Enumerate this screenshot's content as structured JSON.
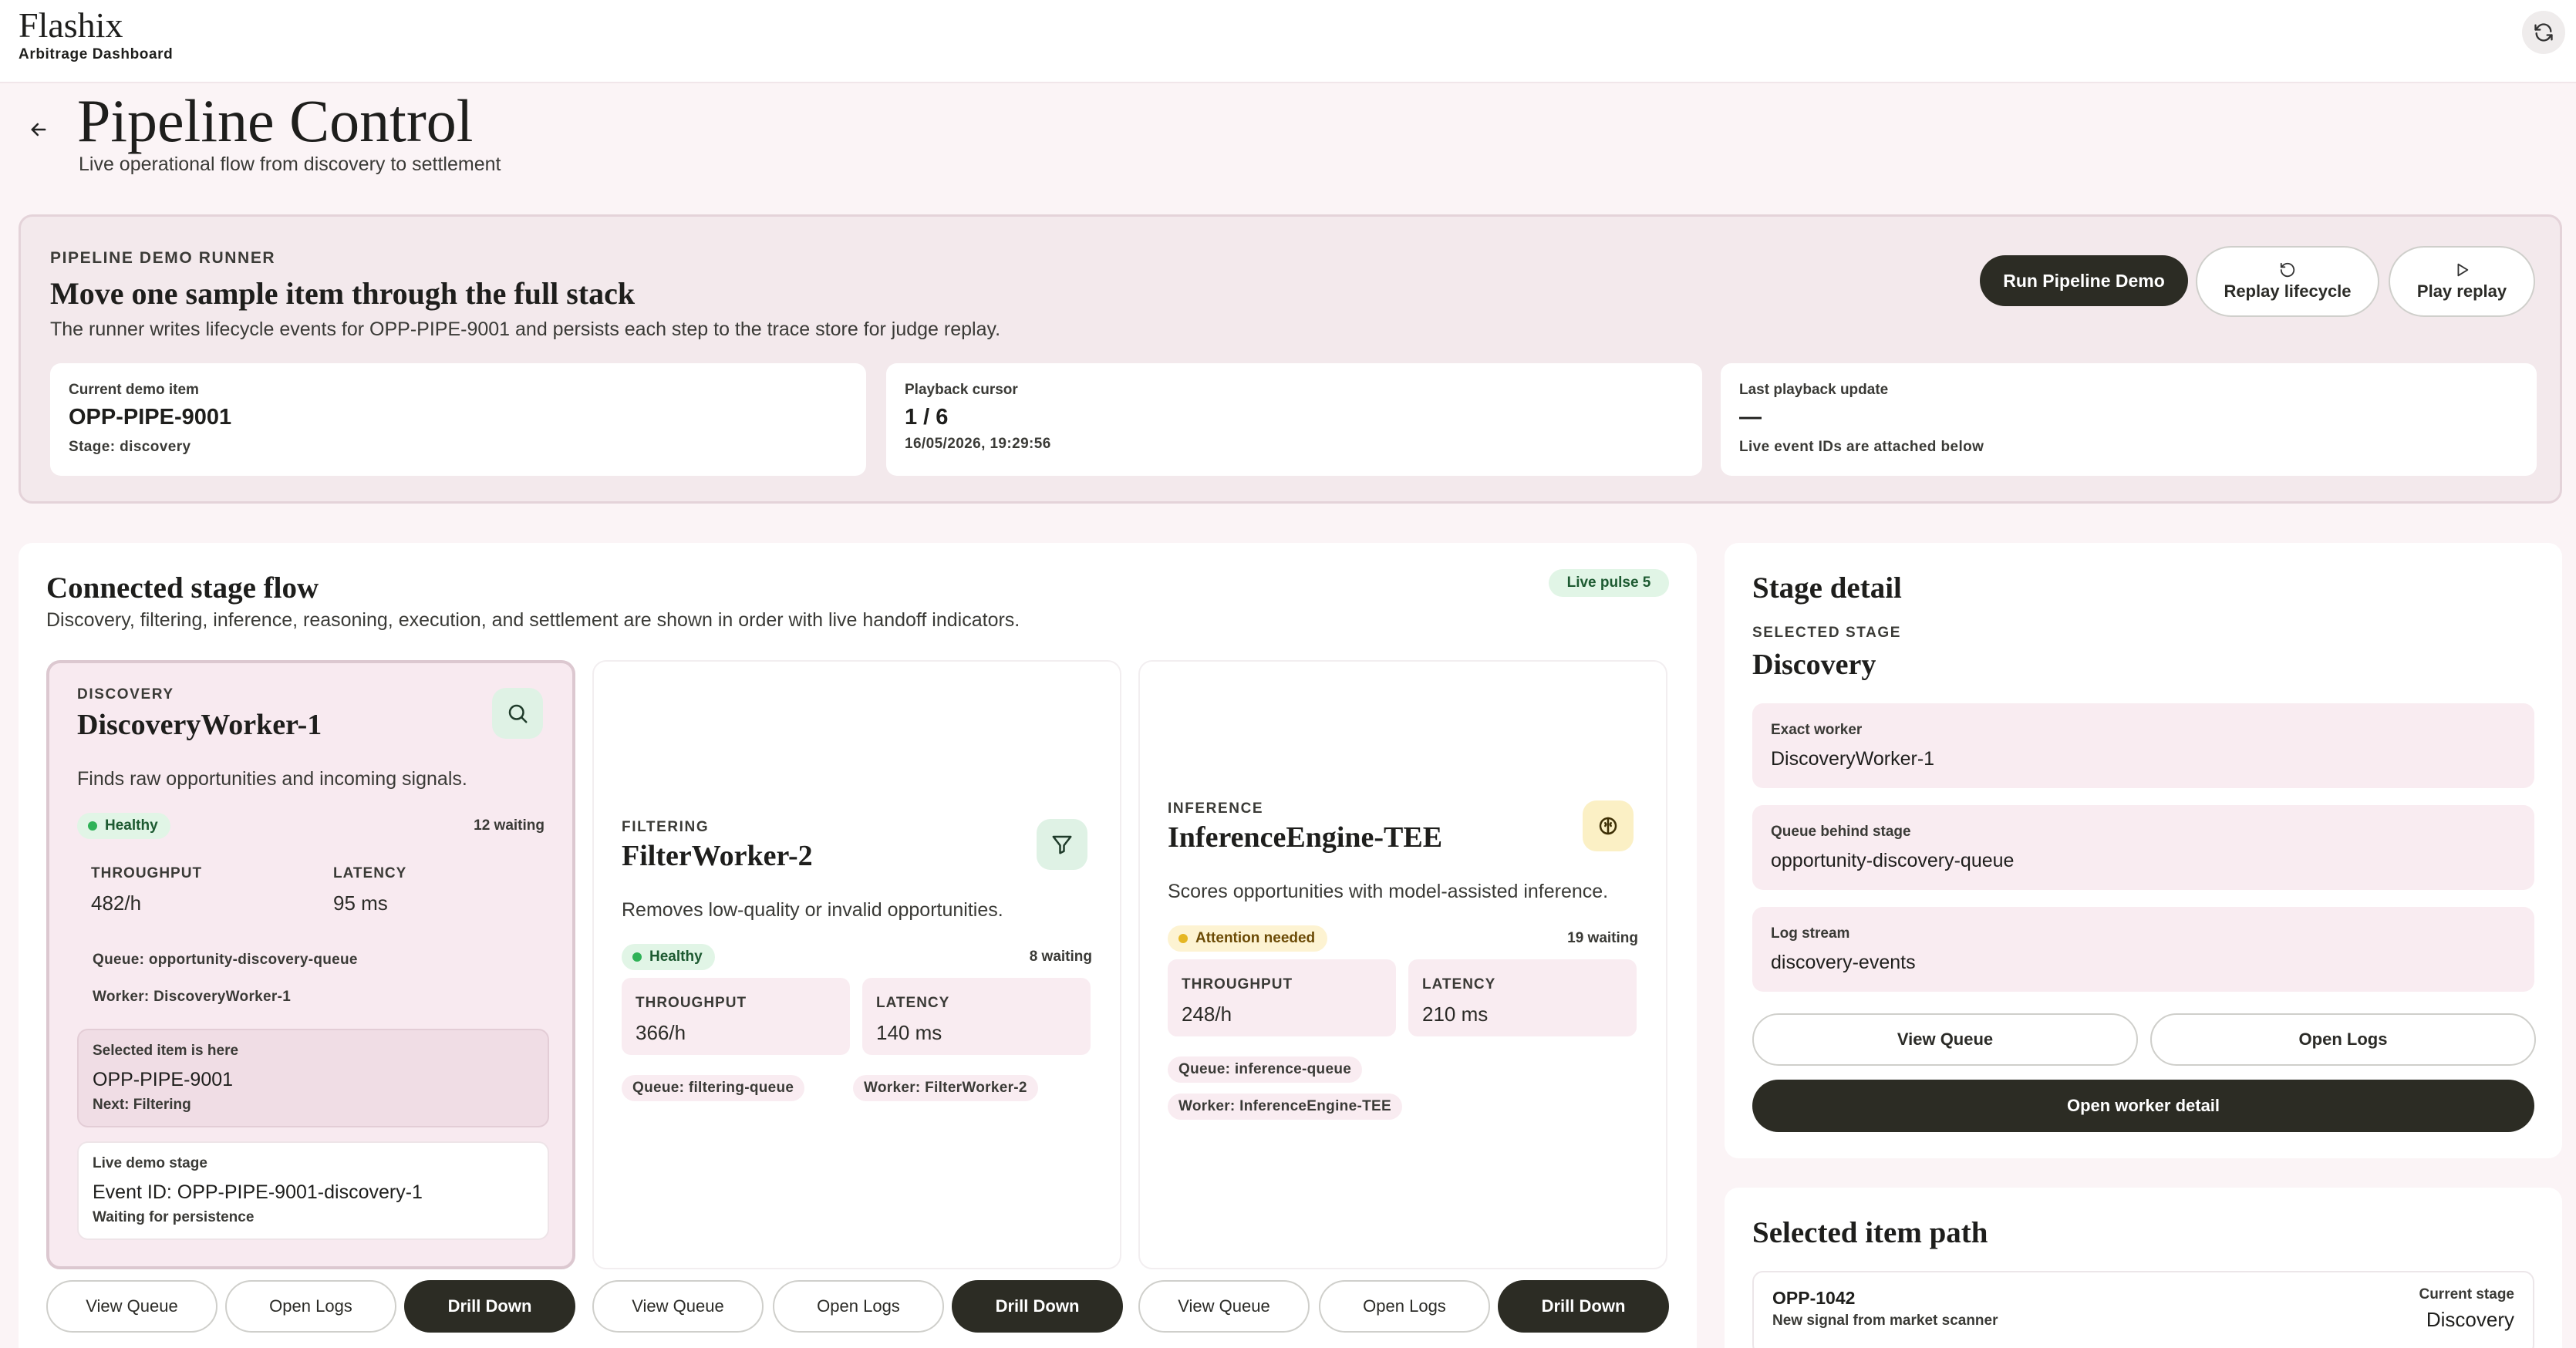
{
  "app": {
    "brand": "Flashix",
    "subtitle": "Arbitrage Dashboard"
  },
  "header": {
    "title": "Pipeline Control",
    "subtitle": "Live operational flow from discovery to settlement"
  },
  "runner": {
    "eyebrow": "PIPELINE DEMO RUNNER",
    "title": "Move one sample item through the full stack",
    "description": "The runner writes lifecycle events for OPP-PIPE-9001 and persists each step to the trace store for judge replay.",
    "run_label": "Run Pipeline Demo",
    "replay_label": "Replay lifecycle",
    "play_label": "Play replay",
    "cards": [
      {
        "label": "Current demo item",
        "value": "OPP-PIPE-9001",
        "sub": "Stage: discovery"
      },
      {
        "label": "Playback cursor",
        "value": "1 / 6",
        "sub": "16/05/2026, 19:29:56"
      },
      {
        "label": "Last playback update",
        "value": "—",
        "sub": "Live event IDs are attached below"
      }
    ]
  },
  "flow": {
    "title": "Connected stage flow",
    "description": "Discovery, filtering, inference, reasoning, execution, and settlement are shown in order with live handoff indicators.",
    "pulse": "Live pulse 5",
    "stages": [
      {
        "eyebrow": "DISCOVERY",
        "title": "DiscoveryWorker-1",
        "icon": "search-icon",
        "description": "Finds raw opportunities and incoming signals.",
        "status": "Healthy",
        "waiting": "12 waiting",
        "throughput_label": "THROUGHPUT",
        "throughput": "482/h",
        "latency_label": "LATENCY",
        "latency": "95 ms",
        "queue": "Queue: opportunity-discovery-queue",
        "worker": "Worker: DiscoveryWorker-1",
        "selected_label": "Selected item is here",
        "selected_value": "OPP-PIPE-9001",
        "selected_next": "Next: Filtering",
        "live_label": "Live demo stage",
        "live_value": "Event ID: OPP-PIPE-9001-discovery-1",
        "live_sub": "Waiting for persistence"
      },
      {
        "eyebrow": "FILTERING",
        "title": "FilterWorker-2",
        "icon": "filter-icon",
        "description": "Removes low-quality or invalid opportunities.",
        "status": "Healthy",
        "waiting": "8 waiting",
        "throughput_label": "THROUGHPUT",
        "throughput": "366/h",
        "latency_label": "LATENCY",
        "latency": "140 ms",
        "queue": "Queue: filtering-queue",
        "worker": "Worker: FilterWorker-2"
      },
      {
        "eyebrow": "INFERENCE",
        "title": "InferenceEngine-TEE",
        "icon": "brain-icon",
        "description": "Scores opportunities with model-assisted inference.",
        "status": "Attention needed",
        "waiting": "19 waiting",
        "throughput_label": "THROUGHPUT",
        "throughput": "248/h",
        "latency_label": "LATENCY",
        "latency": "210 ms",
        "queue": "Queue: inference-queue",
        "worker": "Worker: InferenceEngine-TEE"
      }
    ],
    "buttons": {
      "view_queue": "View Queue",
      "open_logs": "Open Logs",
      "drill_down": "Drill Down"
    }
  },
  "detail": {
    "title": "Stage detail",
    "eyebrow": "SELECTED STAGE",
    "stage": "Discovery",
    "rows": [
      {
        "label": "Exact worker",
        "value": "DiscoveryWorker-1"
      },
      {
        "label": "Queue behind stage",
        "value": "opportunity-discovery-queue"
      },
      {
        "label": "Log stream",
        "value": "discovery-events"
      }
    ],
    "view_queue": "View Queue",
    "open_logs": "Open Logs",
    "open_worker": "Open worker detail"
  },
  "path": {
    "title": "Selected item path",
    "item_id": "OPP-1042",
    "item_desc": "New signal from market scanner",
    "stage_label": "Current stage",
    "stage_value": "Discovery"
  },
  "colors": {
    "accent_dark": "#2c2c24",
    "healthy": "#2fb257",
    "attention": "#e5b623",
    "page_bg": "#fbf4f6"
  }
}
